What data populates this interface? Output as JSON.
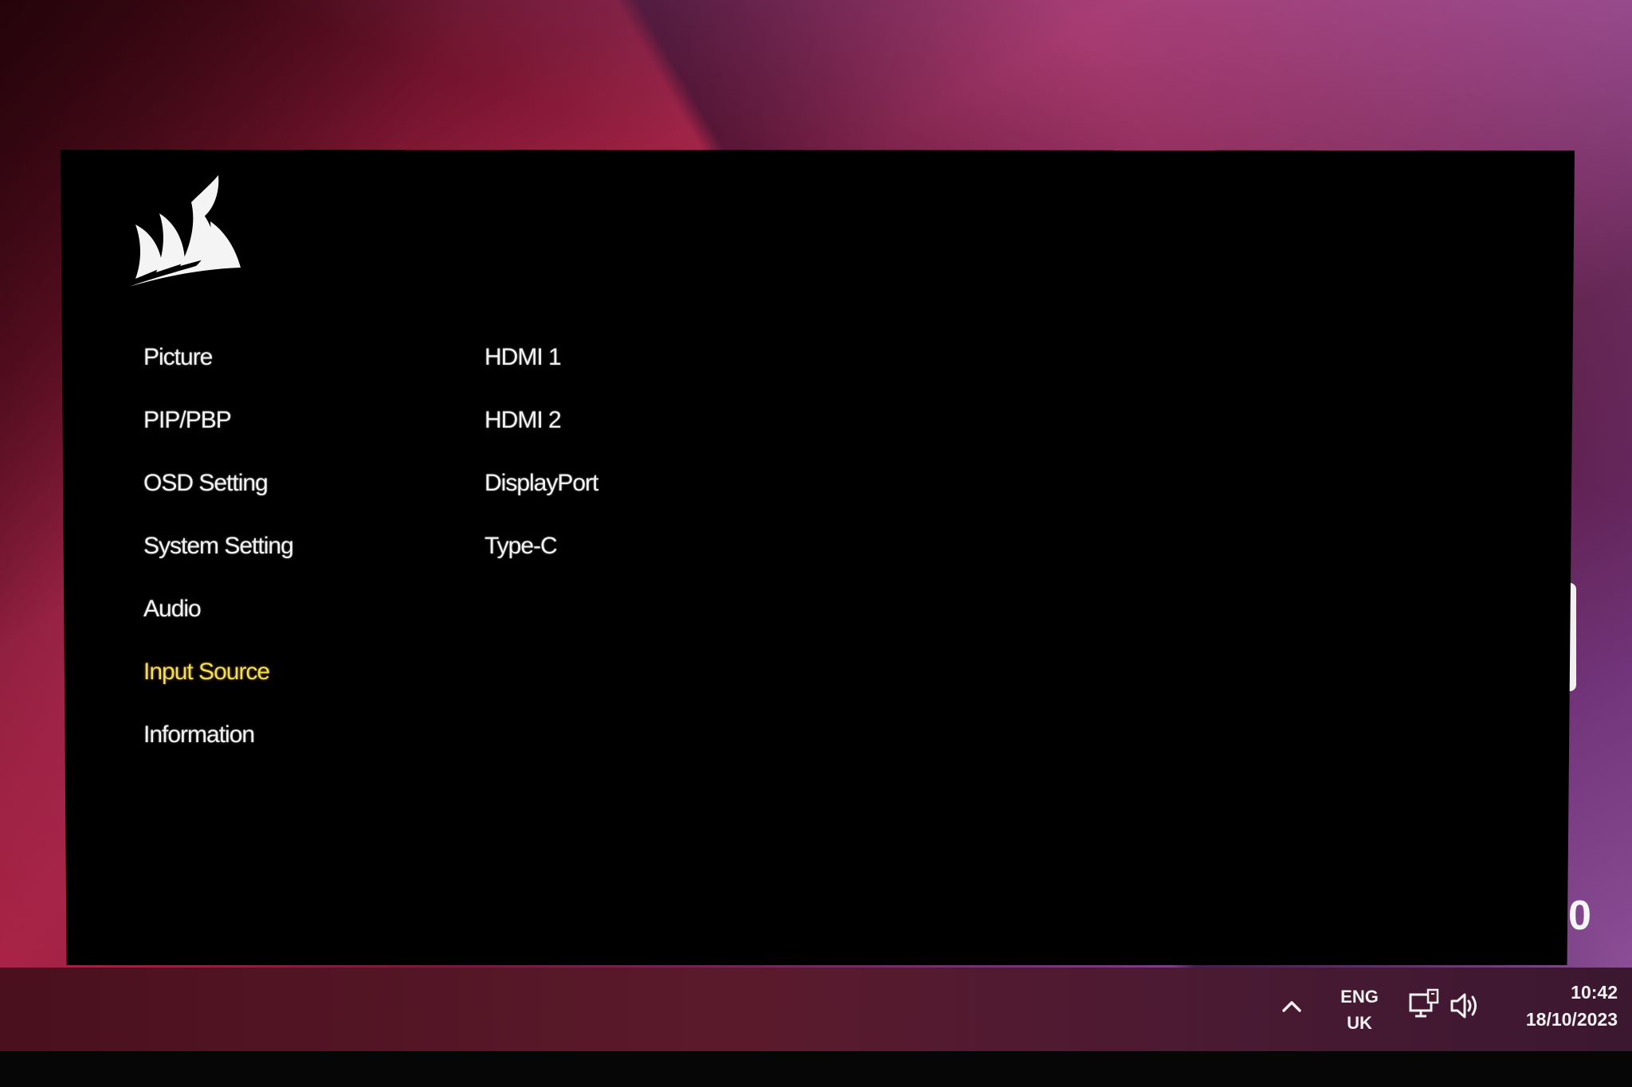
{
  "osd": {
    "brand_icon": "corsair-sails-logo",
    "menu": [
      {
        "label": "Picture",
        "active": false
      },
      {
        "label": "PIP/PBP",
        "active": false
      },
      {
        "label": "OSD Setting",
        "active": false
      },
      {
        "label": "System Setting",
        "active": false
      },
      {
        "label": "Audio",
        "active": false
      },
      {
        "label": "Input Source",
        "active": true
      },
      {
        "label": "Information",
        "active": false
      }
    ],
    "submenu": [
      {
        "label": "HDMI 1"
      },
      {
        "label": "HDMI 2"
      },
      {
        "label": "DisplayPort"
      },
      {
        "label": "Type-C"
      }
    ],
    "active_color": "#e7e44e"
  },
  "desktop": {
    "edge_glyph": "0"
  },
  "taskbar": {
    "tray_chevron_icon": "chevron-up-icon",
    "language": "ENG",
    "keyboard_layout": "UK",
    "network_icon": "network-monitor-icon",
    "volume_icon": "speaker-volume-icon",
    "time": "10:42",
    "date": "18/10/2023"
  }
}
